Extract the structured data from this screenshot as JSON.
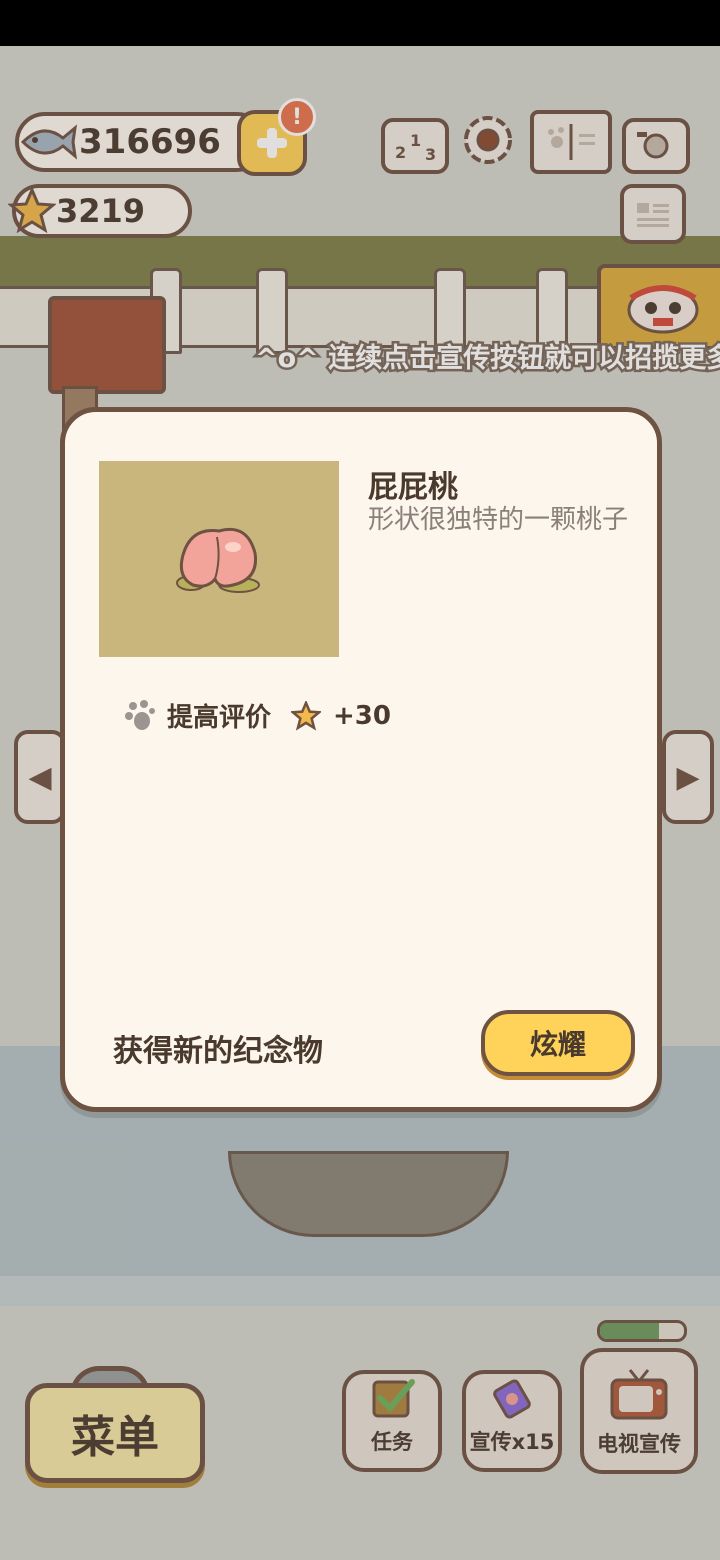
{
  "hud": {
    "fish_count": "316696",
    "star_count": "3219",
    "alert_badge": "!"
  },
  "notice_text": "^o^ 连续点击宣传按钮就可以招揽更多",
  "dialog": {
    "item_name": "屁屁桃",
    "item_desc": "形状很独特的一颗桃子",
    "bonus_label": "提高评价",
    "bonus_value": "+30",
    "footer_text": "获得新的纪念物",
    "show_button": "炫耀"
  },
  "bottom": {
    "menu_label": "菜单",
    "task_label": "任务",
    "promo_label": "宣传x15",
    "tv_label": "电视宣传",
    "tv_progress": 0.7
  },
  "colors": {
    "outline": "#6e5242",
    "dialog_bg": "#fdf6ec",
    "button_yellow": "#ffd25a",
    "thumb_bg": "#c8b67c"
  }
}
